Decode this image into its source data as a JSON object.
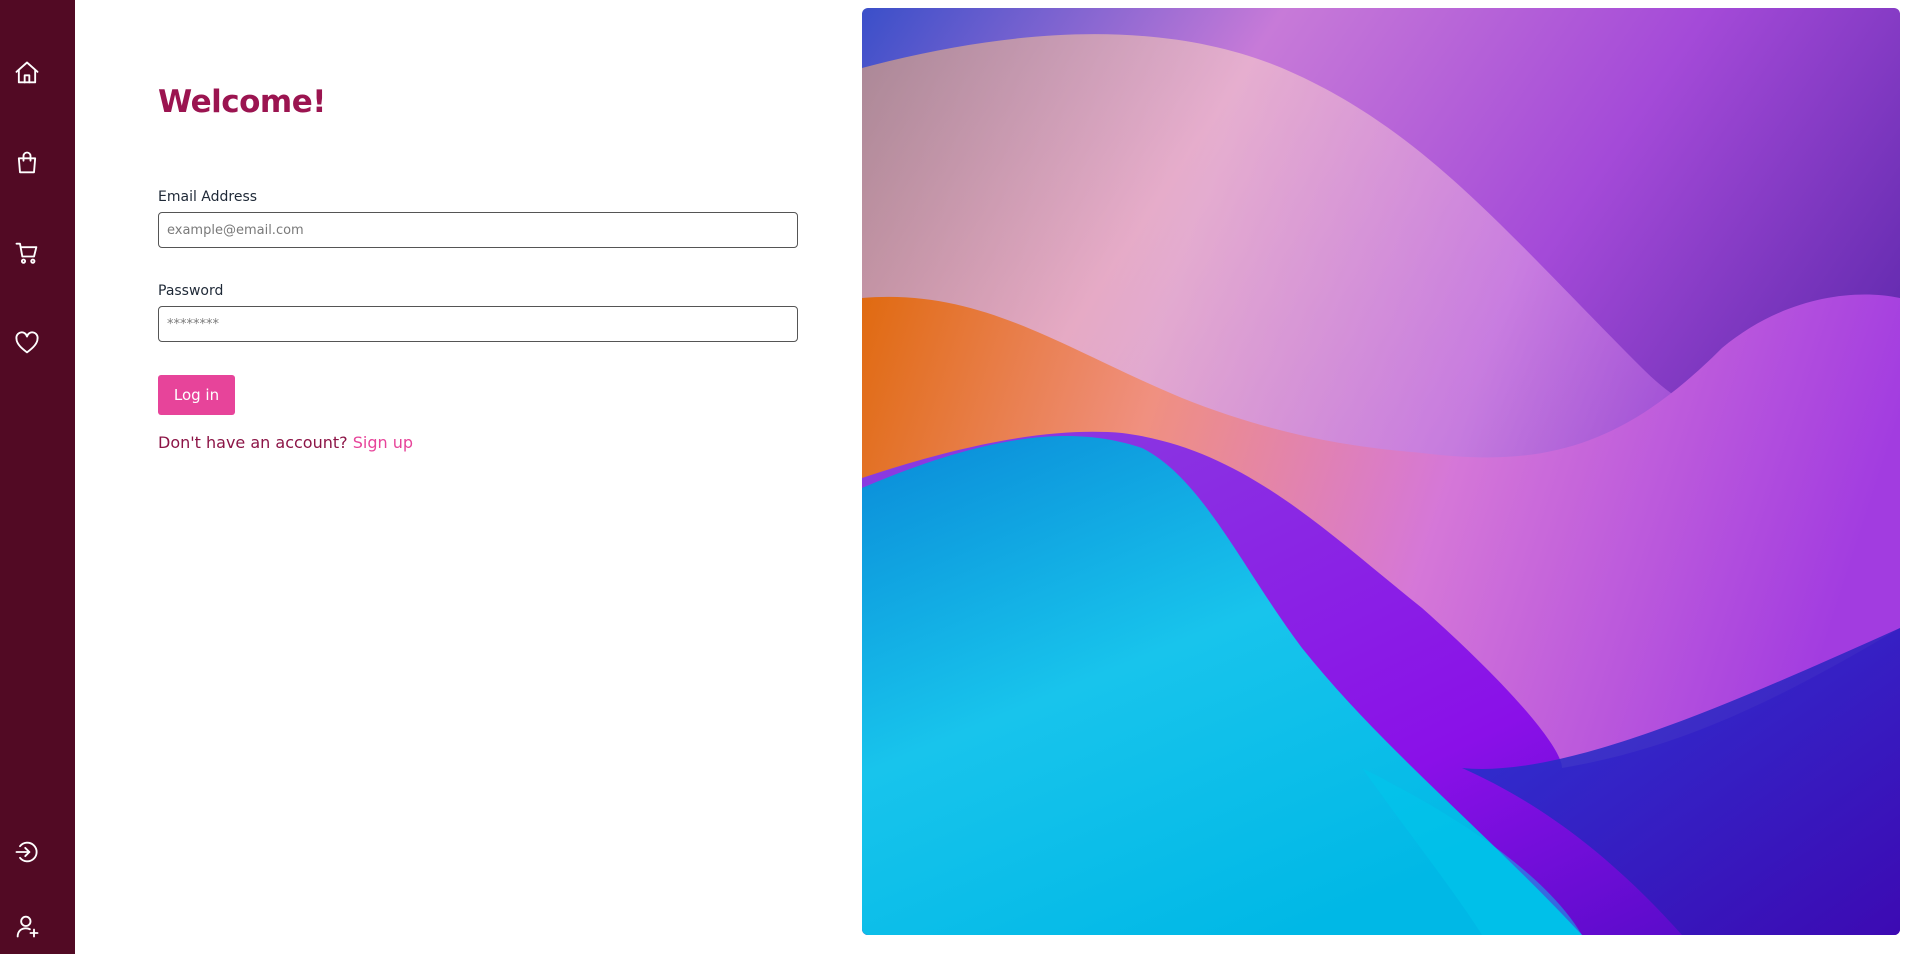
{
  "sidebar": {
    "items": [
      {
        "icon": "home-icon",
        "label": "Home"
      },
      {
        "icon": "shopping-bag-icon",
        "label": "Shop"
      },
      {
        "icon": "cart-icon",
        "label": "Cart"
      },
      {
        "icon": "heart-icon",
        "label": "Favorites"
      },
      {
        "icon": "login-icon",
        "label": "Log in"
      },
      {
        "icon": "user-add-icon",
        "label": "Sign up"
      }
    ],
    "background": "#520a24"
  },
  "form": {
    "title": "Welcome!",
    "email_label": "Email Address",
    "email_placeholder": "example@email.com",
    "password_label": "Password",
    "password_placeholder": "********",
    "login_button": "Log in",
    "signup_prompt": "Don't have an account?",
    "signup_link": "Sign up"
  },
  "colors": {
    "title": "#9b1450",
    "accent": "#e7449a",
    "sidebar": "#520a24"
  }
}
